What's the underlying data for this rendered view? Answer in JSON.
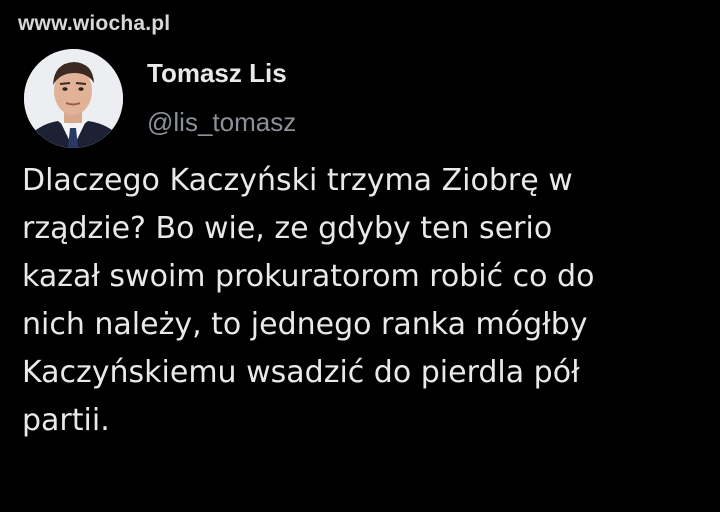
{
  "watermark": "www.wiocha.pl",
  "tweet": {
    "author": {
      "display_name": "Tomasz Lis",
      "handle": "@lis_tomasz",
      "avatar_icon": "profile-photo"
    },
    "text": "Dlaczego Kaczyński trzyma Ziobrę w\nrządzie? Bo wie, ze gdyby ten serio\nkazał swoim prokuratorom robić co do\nnich należy, to jednego ranka mógłby\nKaczyńskiemu wsadzić do pierdla pół\npartii."
  },
  "colors": {
    "background": "#000000",
    "primary_text": "#e7e9ea",
    "secondary_text": "#8b9197",
    "watermark": "#d8d8d8"
  }
}
